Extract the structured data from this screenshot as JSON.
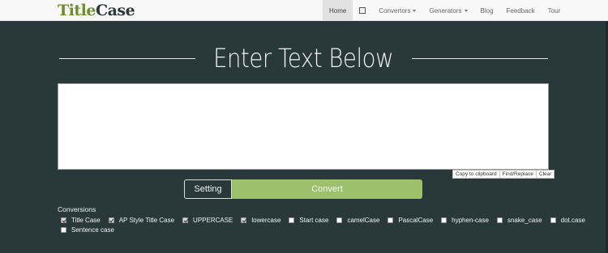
{
  "brand": {
    "part1": "Title",
    "part2": "Case"
  },
  "nav": {
    "home": "Home",
    "icon_name": "square-icon",
    "convertors": "Convertors",
    "generators": "Generators",
    "blog": "Blog",
    "feedback": "Feedback",
    "tour": "Tour"
  },
  "main": {
    "heading": "Enter Text Below",
    "text_value": "",
    "text_placeholder": ""
  },
  "tools": {
    "copy": "Copy to clipboard",
    "find_replace": "Find/Replace",
    "clear": "Clear"
  },
  "actions": {
    "setting": "Setting",
    "convert": "Convert"
  },
  "conversions": {
    "title": "Conversions",
    "options": [
      {
        "label": "Title Case",
        "checked": true
      },
      {
        "label": "AP Style Title Case",
        "checked": true
      },
      {
        "label": "UPPERCASE",
        "checked": true
      },
      {
        "label": "lowercase",
        "checked": true
      },
      {
        "label": "Start case",
        "checked": false
      },
      {
        "label": "camelCase",
        "checked": false
      },
      {
        "label": "PascalCase",
        "checked": false
      },
      {
        "label": "hyphen-case",
        "checked": false
      },
      {
        "label": "snake_case",
        "checked": false
      },
      {
        "label": "dot.case",
        "checked": false
      },
      {
        "label": "Sentence case",
        "checked": false
      }
    ]
  },
  "colors": {
    "background": "#29393a",
    "accent": "#9dc06d",
    "logo_green": "#6d8e2b",
    "navbar": "#f8f8f8"
  }
}
